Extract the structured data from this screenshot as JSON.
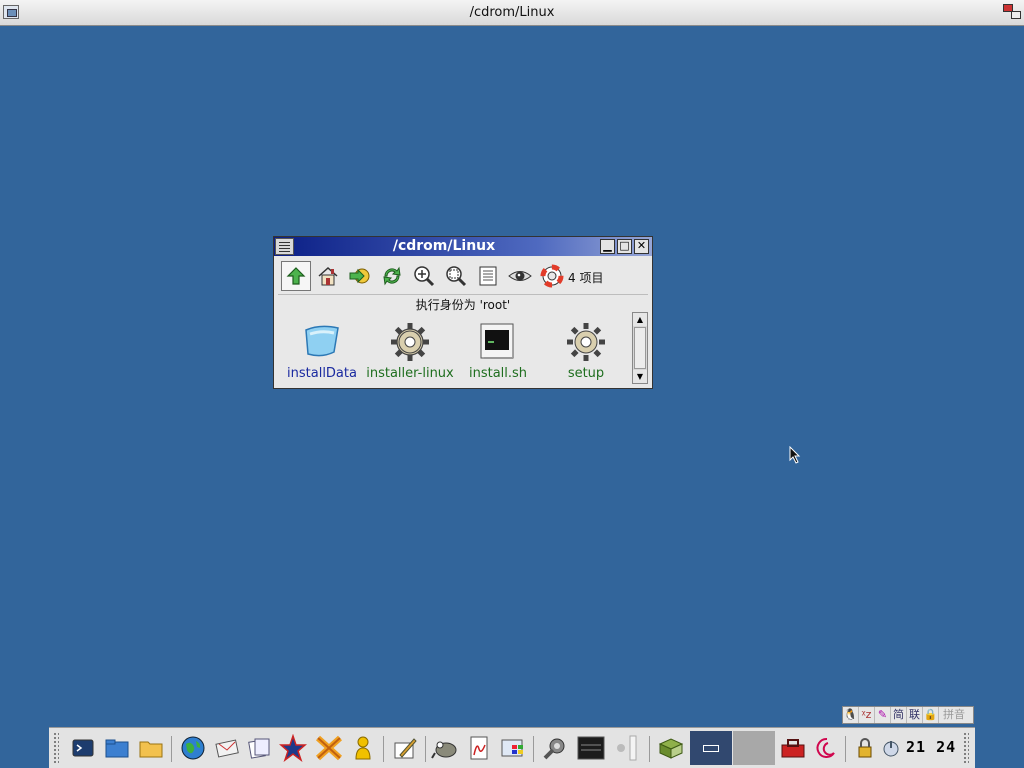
{
  "topbar": {
    "title": "/cdrom/Linux"
  },
  "window": {
    "title": "/cdrom/Linux",
    "buttons": {
      "minimize": "▁",
      "maximize": "□",
      "close": "✕"
    },
    "toolbar": [
      "up",
      "home",
      "forward",
      "refresh",
      "zoom-in",
      "zoom-fit",
      "details",
      "view",
      "help"
    ],
    "item_count": "4 项目",
    "run_as": "执行身份为 'root'",
    "files": [
      {
        "name": "installData",
        "type": "folder"
      },
      {
        "name": "installer-linux",
        "type": "executable"
      },
      {
        "name": "install.sh",
        "type": "script"
      },
      {
        "name": "setup",
        "type": "executable"
      }
    ]
  },
  "ime_bar": {
    "items": [
      "tux",
      "xz",
      "pen",
      "zh-jian",
      "联",
      "lock",
      "拼音"
    ]
  },
  "taskbar": {
    "launchers": [
      "terminal",
      "file-manager",
      "folder",
      "browser",
      "mail",
      "notes",
      "kde",
      "xtrans",
      "user",
      "editor",
      "gimp",
      "pdf",
      "windows",
      "settings",
      "monitor",
      "slider",
      "books"
    ],
    "pager": [
      "desktop-1",
      "desktop-2"
    ],
    "tray": [
      "toolbox",
      "debian",
      "lock",
      "power"
    ],
    "clock": "21 24"
  },
  "colors": {
    "desktop": "#32659b",
    "titlebar_start": "#0b1f86",
    "titlebar_end": "#97a6d6"
  }
}
